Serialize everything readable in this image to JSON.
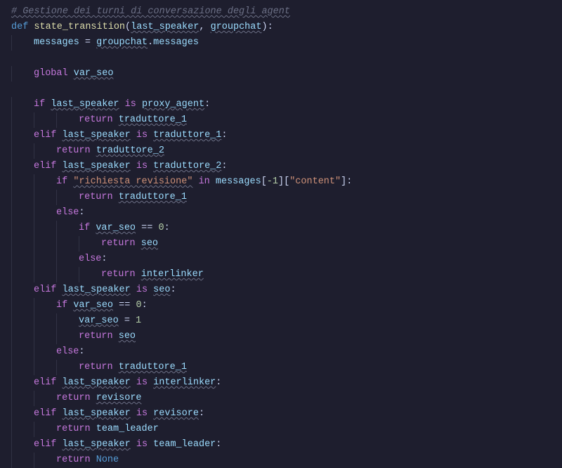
{
  "lines": [
    {
      "indent": 0,
      "segments": [
        {
          "class": "comment wavy",
          "text": "# Gestione dei turni di conversazione degli agent"
        }
      ]
    },
    {
      "indent": 0,
      "segments": [
        {
          "class": "def-kw",
          "text": "def "
        },
        {
          "class": "func-name",
          "text": "state_transition"
        },
        {
          "class": "punct",
          "text": "("
        },
        {
          "class": "param wavy",
          "text": "last_speaker"
        },
        {
          "class": "punct",
          "text": ", "
        },
        {
          "class": "param wavy",
          "text": "groupchat"
        },
        {
          "class": "punct",
          "text": "):"
        }
      ]
    },
    {
      "indent": 1,
      "segments": [
        {
          "class": "variable",
          "text": "messages"
        },
        {
          "class": "operator",
          "text": " = "
        },
        {
          "class": "variable wavy",
          "text": "groupchat"
        },
        {
          "class": "punct",
          "text": "."
        },
        {
          "class": "property",
          "text": "messages"
        }
      ]
    },
    {
      "indent": 0,
      "segments": []
    },
    {
      "indent": 1,
      "segments": [
        {
          "class": "keyword",
          "text": "global"
        },
        {
          "class": "ident",
          "text": " "
        },
        {
          "class": "variable wavy",
          "text": "var_seo"
        }
      ]
    },
    {
      "indent": 0,
      "segments": []
    },
    {
      "indent": 1,
      "segments": [
        {
          "class": "keyword",
          "text": "if"
        },
        {
          "class": "ident",
          "text": " "
        },
        {
          "class": "variable wavy",
          "text": "last_speaker"
        },
        {
          "class": "ident",
          "text": " "
        },
        {
          "class": "keyword",
          "text": "is"
        },
        {
          "class": "ident",
          "text": " "
        },
        {
          "class": "variable wavy",
          "text": "proxy_agent"
        },
        {
          "class": "punct",
          "text": ":"
        }
      ]
    },
    {
      "indent": 3,
      "segments": [
        {
          "class": "keyword",
          "text": "return"
        },
        {
          "class": "ident",
          "text": " "
        },
        {
          "class": "variable wavy",
          "text": "traduttore_1"
        }
      ]
    },
    {
      "indent": 1,
      "segments": [
        {
          "class": "keyword",
          "text": "elif"
        },
        {
          "class": "ident",
          "text": " "
        },
        {
          "class": "variable wavy",
          "text": "last_speaker"
        },
        {
          "class": "ident",
          "text": " "
        },
        {
          "class": "keyword",
          "text": "is"
        },
        {
          "class": "ident",
          "text": " "
        },
        {
          "class": "variable wavy",
          "text": "traduttore_1"
        },
        {
          "class": "punct",
          "text": ":"
        }
      ]
    },
    {
      "indent": 2,
      "segments": [
        {
          "class": "keyword",
          "text": "return"
        },
        {
          "class": "ident",
          "text": " "
        },
        {
          "class": "variable wavy",
          "text": "traduttore_2"
        }
      ]
    },
    {
      "indent": 1,
      "segments": [
        {
          "class": "keyword",
          "text": "elif"
        },
        {
          "class": "ident",
          "text": " "
        },
        {
          "class": "variable wavy",
          "text": "last_speaker"
        },
        {
          "class": "ident",
          "text": " "
        },
        {
          "class": "keyword",
          "text": "is"
        },
        {
          "class": "ident",
          "text": " "
        },
        {
          "class": "variable wavy",
          "text": "traduttore_2"
        },
        {
          "class": "punct",
          "text": ":"
        }
      ]
    },
    {
      "indent": 2,
      "segments": [
        {
          "class": "keyword",
          "text": "if"
        },
        {
          "class": "ident",
          "text": " "
        },
        {
          "class": "string wavy",
          "text": "\"richiesta revisione\""
        },
        {
          "class": "ident",
          "text": " "
        },
        {
          "class": "keyword",
          "text": "in"
        },
        {
          "class": "ident",
          "text": " "
        },
        {
          "class": "variable",
          "text": "messages"
        },
        {
          "class": "punct",
          "text": "["
        },
        {
          "class": "number",
          "text": "-1"
        },
        {
          "class": "punct",
          "text": "]["
        },
        {
          "class": "string",
          "text": "\"content\""
        },
        {
          "class": "punct",
          "text": "]:"
        }
      ]
    },
    {
      "indent": 3,
      "segments": [
        {
          "class": "keyword",
          "text": "return"
        },
        {
          "class": "ident",
          "text": " "
        },
        {
          "class": "variable wavy",
          "text": "traduttore_1"
        }
      ]
    },
    {
      "indent": 2,
      "segments": [
        {
          "class": "keyword",
          "text": "else"
        },
        {
          "class": "punct",
          "text": ":"
        }
      ]
    },
    {
      "indent": 3,
      "segments": [
        {
          "class": "keyword",
          "text": "if"
        },
        {
          "class": "ident",
          "text": " "
        },
        {
          "class": "variable wavy",
          "text": "var_seo"
        },
        {
          "class": "ident",
          "text": " "
        },
        {
          "class": "operator",
          "text": "=="
        },
        {
          "class": "ident",
          "text": " "
        },
        {
          "class": "number",
          "text": "0"
        },
        {
          "class": "punct",
          "text": ":"
        }
      ]
    },
    {
      "indent": 4,
      "segments": [
        {
          "class": "keyword",
          "text": "return"
        },
        {
          "class": "ident",
          "text": " "
        },
        {
          "class": "variable wavy",
          "text": "seo"
        }
      ]
    },
    {
      "indent": 3,
      "segments": [
        {
          "class": "keyword",
          "text": "else"
        },
        {
          "class": "punct",
          "text": ":"
        }
      ]
    },
    {
      "indent": 4,
      "segments": [
        {
          "class": "keyword",
          "text": "return"
        },
        {
          "class": "ident",
          "text": " "
        },
        {
          "class": "variable wavy",
          "text": "interlinker"
        }
      ]
    },
    {
      "indent": 1,
      "segments": [
        {
          "class": "keyword",
          "text": "elif"
        },
        {
          "class": "ident",
          "text": " "
        },
        {
          "class": "variable wavy",
          "text": "last_speaker"
        },
        {
          "class": "ident",
          "text": " "
        },
        {
          "class": "keyword",
          "text": "is"
        },
        {
          "class": "ident",
          "text": " "
        },
        {
          "class": "variable wavy",
          "text": "seo"
        },
        {
          "class": "punct",
          "text": ":"
        }
      ]
    },
    {
      "indent": 2,
      "segments": [
        {
          "class": "keyword",
          "text": "if"
        },
        {
          "class": "ident",
          "text": " "
        },
        {
          "class": "variable wavy",
          "text": "var_seo"
        },
        {
          "class": "ident",
          "text": " "
        },
        {
          "class": "operator",
          "text": "=="
        },
        {
          "class": "ident",
          "text": " "
        },
        {
          "class": "number",
          "text": "0"
        },
        {
          "class": "punct",
          "text": ":"
        }
      ]
    },
    {
      "indent": 3,
      "segments": [
        {
          "class": "variable wavy",
          "text": "var_seo"
        },
        {
          "class": "operator",
          "text": " = "
        },
        {
          "class": "number",
          "text": "1"
        }
      ]
    },
    {
      "indent": 3,
      "segments": [
        {
          "class": "keyword",
          "text": "return"
        },
        {
          "class": "ident",
          "text": " "
        },
        {
          "class": "variable wavy",
          "text": "seo"
        }
      ]
    },
    {
      "indent": 2,
      "segments": [
        {
          "class": "keyword",
          "text": "else"
        },
        {
          "class": "punct",
          "text": ":"
        }
      ]
    },
    {
      "indent": 3,
      "segments": [
        {
          "class": "keyword",
          "text": "return"
        },
        {
          "class": "ident",
          "text": " "
        },
        {
          "class": "variable wavy",
          "text": "traduttore_1"
        }
      ]
    },
    {
      "indent": 1,
      "segments": [
        {
          "class": "keyword",
          "text": "elif"
        },
        {
          "class": "ident",
          "text": " "
        },
        {
          "class": "variable wavy",
          "text": "last_speaker"
        },
        {
          "class": "ident",
          "text": " "
        },
        {
          "class": "keyword",
          "text": "is"
        },
        {
          "class": "ident",
          "text": " "
        },
        {
          "class": "variable wavy",
          "text": "interlinker"
        },
        {
          "class": "punct",
          "text": ":"
        }
      ]
    },
    {
      "indent": 2,
      "segments": [
        {
          "class": "keyword",
          "text": "return"
        },
        {
          "class": "ident",
          "text": " "
        },
        {
          "class": "variable wavy",
          "text": "revisore"
        }
      ]
    },
    {
      "indent": 1,
      "segments": [
        {
          "class": "keyword",
          "text": "elif"
        },
        {
          "class": "ident",
          "text": " "
        },
        {
          "class": "variable wavy",
          "text": "last_speaker"
        },
        {
          "class": "ident",
          "text": " "
        },
        {
          "class": "keyword",
          "text": "is"
        },
        {
          "class": "ident",
          "text": " "
        },
        {
          "class": "variable wavy",
          "text": "revisore"
        },
        {
          "class": "punct",
          "text": ":"
        }
      ]
    },
    {
      "indent": 2,
      "segments": [
        {
          "class": "keyword",
          "text": "return"
        },
        {
          "class": "ident",
          "text": " "
        },
        {
          "class": "variable",
          "text": "team_leader"
        }
      ]
    },
    {
      "indent": 1,
      "segments": [
        {
          "class": "keyword",
          "text": "elif"
        },
        {
          "class": "ident",
          "text": " "
        },
        {
          "class": "variable wavy",
          "text": "last_speaker"
        },
        {
          "class": "ident",
          "text": " "
        },
        {
          "class": "keyword",
          "text": "is"
        },
        {
          "class": "ident",
          "text": " "
        },
        {
          "class": "variable",
          "text": "team_leader"
        },
        {
          "class": "punct",
          "text": ":"
        }
      ]
    },
    {
      "indent": 2,
      "segments": [
        {
          "class": "keyword",
          "text": "return"
        },
        {
          "class": "ident",
          "text": " "
        },
        {
          "class": "none-kw",
          "text": "None"
        }
      ]
    }
  ]
}
